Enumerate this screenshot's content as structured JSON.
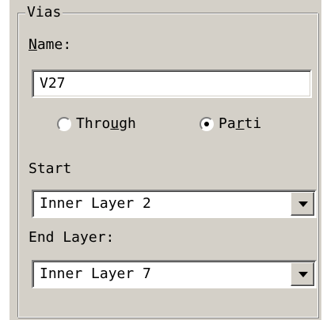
{
  "group": {
    "title": "Vias"
  },
  "name_field": {
    "label_accel": "N",
    "label_rest": "ame:",
    "value": "V27"
  },
  "via_type": {
    "through": {
      "label_pre": "Thro",
      "label_accel": "u",
      "label_post": "gh",
      "selected": false
    },
    "partial": {
      "label_pre": "Pa",
      "label_accel": "r",
      "label_post": "ti",
      "selected": true
    }
  },
  "start": {
    "label": "Start",
    "value": "Inner Layer 2"
  },
  "end_layer": {
    "label": "End Layer:",
    "value": "Inner Layer 7"
  },
  "icons": {
    "dropdown": "chevron-down-icon",
    "radio": "radio-icon"
  },
  "colors": {
    "panel": "#d4d0c8",
    "field": "#ffffff",
    "text": "#000000"
  }
}
